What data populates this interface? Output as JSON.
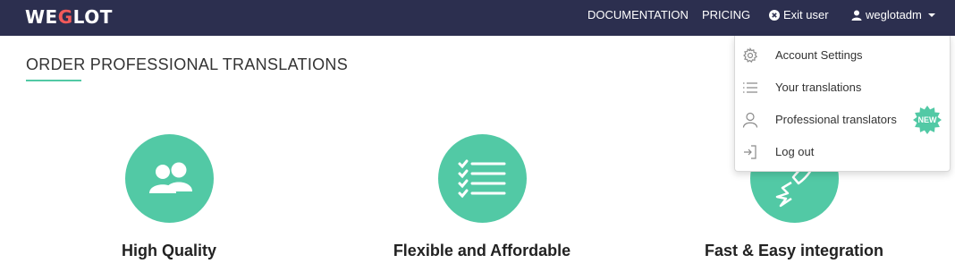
{
  "nav": {
    "logo_pre": "WE",
    "logo_accent": "G",
    "logo_post": "LOT",
    "links": {
      "documentation": "DOCUMENTATION",
      "pricing": "PRICING",
      "exit_user": "Exit user",
      "username": "weglotadm"
    }
  },
  "main": {
    "title": "ORDER PROFESSIONAL TRANSLATIONS",
    "features": {
      "quality": {
        "title": "High Quality",
        "icon": "users-icon"
      },
      "flexible": {
        "title": "Flexible and Affordable",
        "icon": "checklist-icon"
      },
      "fast": {
        "title": "Fast & Easy integration",
        "icon": "rocket-icon"
      }
    }
  },
  "dropdown": {
    "items": [
      {
        "label": "Account Settings",
        "icon": "gear-icon"
      },
      {
        "label": "Your translations",
        "icon": "list-icon"
      },
      {
        "label": "Professional translators",
        "icon": "user-icon"
      },
      {
        "label": "Log out",
        "icon": "logout-icon"
      }
    ],
    "badge": "NEW"
  },
  "colors": {
    "navbar": "#2c2f4f",
    "accent": "#52c9a5",
    "logo_accent": "#f25a5a"
  }
}
